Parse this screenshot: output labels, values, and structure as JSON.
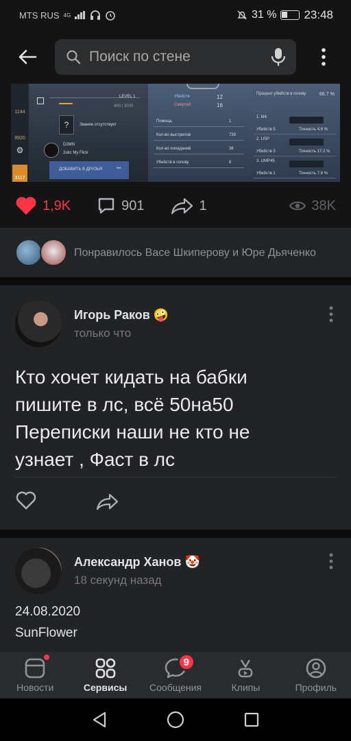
{
  "status_bar": {
    "carrier": "MTS RUS",
    "network": "4G",
    "battery_percent": "31 %",
    "time": "23:48"
  },
  "header": {
    "search_placeholder": "Поиск по стене"
  },
  "image_post": {
    "game_screenshot": {
      "level": "LEVEL 1",
      "xp": "400 | 3000",
      "rank_text": "Звание отсутствует",
      "clan": "D2MN",
      "player": "2ukc My Flick",
      "add_friend": "ДОБАВИТЬ В ДРУЗЬЯ",
      "sidebar_counts": [
        "1144",
        "8920",
        "3117"
      ],
      "kills_label": "Убийств",
      "kills": "12",
      "deaths_label": "Смертей",
      "deaths": "16",
      "headshot_label": "Процент убийств в голову",
      "headshot_pct": "66.7 %",
      "stats": [
        {
          "label": "Помощь",
          "value": "1"
        },
        {
          "label": "Кол-во выстрелов",
          "value": "739"
        },
        {
          "label": "Кол-во попаданий",
          "value": "36"
        },
        {
          "label": "Убийств в голову",
          "value": "8"
        }
      ],
      "weapons": [
        {
          "name": "1. M4",
          "kills": "5",
          "accuracy": "4.6 %"
        },
        {
          "name": "2. USP",
          "kills": "3",
          "accuracy": "17.2 %"
        },
        {
          "name": "3. UMP45",
          "kills": "1",
          "accuracy": "7.8 %"
        }
      ],
      "weapon_kills_label": "Убийств",
      "weapon_acc_label": "Точность"
    },
    "likes": "1,9K",
    "comments": "901",
    "shares": "1",
    "views": "38K",
    "liked_by": "Понравилось Васе Шкиперову и Юре Дьяченко"
  },
  "post1": {
    "author": "Игорь Раков 🤪",
    "time": "только что",
    "text_lines": [
      "Кто хочет кидать на бабки",
      "пишите в лс, всё 50на50",
      "Переписки наши не кто не",
      "узнает , Фаст в лс"
    ]
  },
  "post2": {
    "author": "Александр Ханов 🤡",
    "time": "18 секунд назад",
    "line1": "24.08.2020",
    "line2": "SunFlower"
  },
  "tabbar": {
    "items": [
      {
        "label": "Новости",
        "icon": "news-icon"
      },
      {
        "label": "Сервисы",
        "icon": "services-icon"
      },
      {
        "label": "Сообщения",
        "icon": "messages-icon",
        "badge": "9"
      },
      {
        "label": "Клипы",
        "icon": "clips-icon"
      },
      {
        "label": "Профиль",
        "icon": "profile-icon"
      }
    ]
  },
  "colors": {
    "accent_red": "#ff3347",
    "background": "#141414",
    "card": "#222325"
  }
}
